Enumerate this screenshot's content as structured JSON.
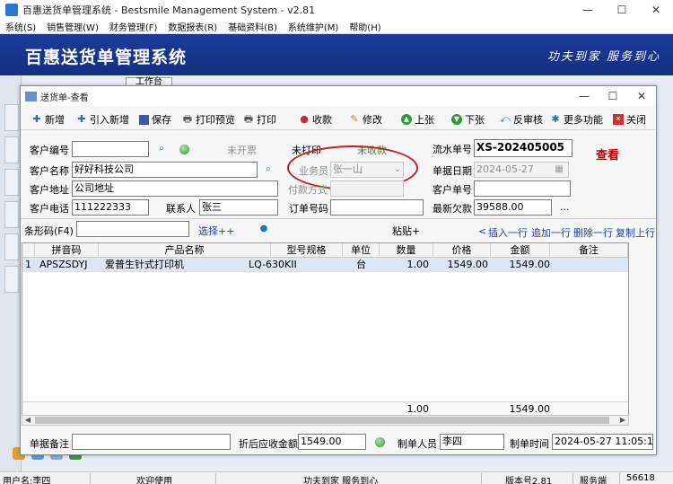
{
  "main": {
    "title": "百惠送货单管理系统 - Bestsmile Management System - v2.81",
    "menu": [
      "系统(S)",
      "销售管理(W)",
      "财务管理(F)",
      "数据报表(R)",
      "基础资料(B)",
      "系统维护(M)",
      "帮助(H)"
    ],
    "system_name": "百惠送货单管理系统",
    "slogan": "功夫到家 服务到心",
    "work_tab": "工作台"
  },
  "dialog": {
    "title": "送货单-查看",
    "toolbar": [
      "新增",
      "引入新增",
      "保存",
      "打印预览",
      "打印",
      "收款",
      "修改",
      "上张",
      "下张",
      "反审核",
      "更多功能",
      "关闭"
    ],
    "form": {
      "customer_code_label": "客户编号",
      "customer_code": "",
      "invoice_status": "未开票",
      "print_status": "未打印",
      "payment_status": "未收款",
      "serial_label": "流水单号",
      "serial_value": "XS-202405005",
      "mode": "查看",
      "customer_name_label": "客户名称",
      "customer_name": "好好科技公司",
      "salesman_label": "业务员",
      "salesman": "张一山",
      "doc_date_label": "单据日期",
      "doc_date": "2024-05-27",
      "address_label": "客户地址",
      "address": "公司地址",
      "pay_method_label": "付款方式",
      "pay_method": "",
      "customer_order_label": "客户单号",
      "customer_order": "",
      "phone_label": "客户电话",
      "phone": "111222333",
      "contact_label": "联系人",
      "contact": "张三",
      "order_no_label": "订单号码",
      "order_no": "",
      "latest_debt_label": "最新欠款",
      "latest_debt": "39588.00",
      "ellipsis": "..."
    },
    "barcode_label": "条形码(F4)",
    "barcode_value": "",
    "select_link": "选择++",
    "paste": "粘贴+",
    "row_actions": [
      "插入一行",
      "追加一行",
      "删除一行",
      "复制上行"
    ],
    "table": {
      "headers": [
        "拼音码",
        "产品名称",
        "型号规格",
        "单位",
        "数量",
        "价格",
        "金额",
        "备注"
      ],
      "rows": [
        {
          "no": "1",
          "pinyin": "APSZSDYJ",
          "name": "爱普生针式打印机",
          "model": "LQ-630KII",
          "unit": "台",
          "qty": "1.00",
          "price": "1549.00",
          "amount": "1549.00",
          "remark": ""
        }
      ],
      "footer": {
        "qty": "1.00",
        "amount": "1549.00"
      }
    },
    "bottom": {
      "remark_label": "单据备注",
      "remark": "",
      "discount_label": "折后应收金额",
      "discount_value": "1549.00",
      "maker_label": "制单人员",
      "maker": "李四",
      "make_time_label": "制单时间",
      "make_time": "2024-05-27 11:05:17"
    }
  },
  "status": {
    "user": "用户名:李四",
    "welcome": "欢迎使用",
    "slogan": "功夫到家 服务到心",
    "version": "版本号2.81",
    "server": "服务端",
    "port": "56618"
  }
}
